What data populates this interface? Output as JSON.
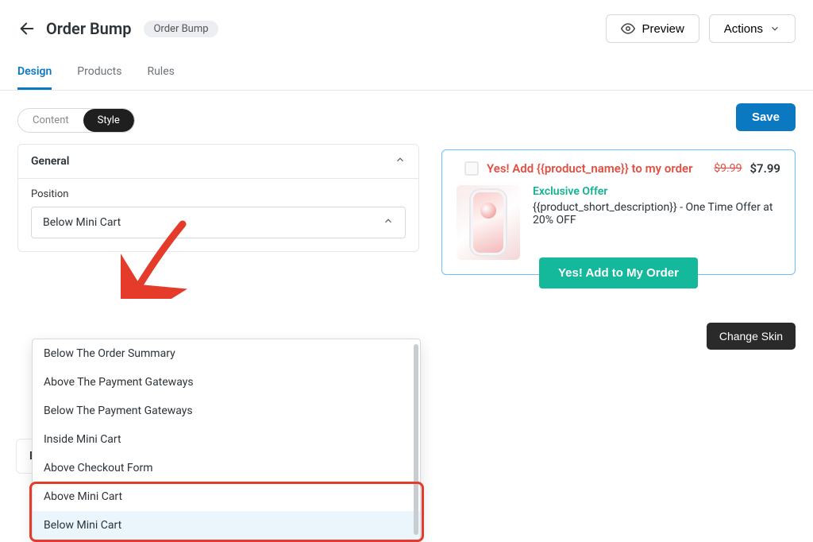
{
  "header": {
    "title": "Order Bump",
    "tag": "Order Bump",
    "preview": "Preview",
    "actions": "Actions"
  },
  "tabs": {
    "design": "Design",
    "products": "Products",
    "rules": "Rules"
  },
  "toggle": {
    "content": "Content",
    "style": "Style"
  },
  "save": "Save",
  "general": {
    "title": "General",
    "position_label": "Position",
    "selected": "Below Mini Cart"
  },
  "options": {
    "below_order_summary": "Below The Order Summary",
    "above_payment": "Above The Payment Gateways",
    "below_payment": "Below The Payment Gateways",
    "inside_mini": "Inside Mini Cart",
    "above_checkout": "Above Checkout Form",
    "above_mini": "Above Mini Cart",
    "below_mini": "Below Mini Cart"
  },
  "buttons_panel": "Buttons",
  "offer": {
    "title": "Yes! Add {{product_name}} to my order",
    "strike": "$9.99",
    "price": "$7.99",
    "sub": "Exclusive Offer",
    "desc": "{{product_short_description}} - One Time Offer at 20% OFF",
    "cta": "Yes! Add to My Order"
  },
  "change_skin": "Change Skin"
}
